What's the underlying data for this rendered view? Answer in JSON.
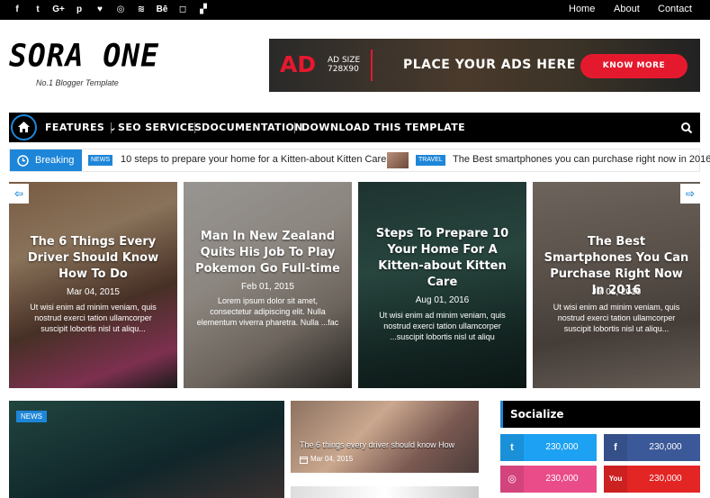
{
  "topbar": {
    "social_icons": [
      "facebook-icon",
      "twitter-icon",
      "google-plus-icon",
      "pinterest-icon",
      "heart-icon",
      "dribbble-icon",
      "rss-icon",
      "behance-icon",
      "instagram-icon",
      "delicious-icon"
    ],
    "social_glyphs": [
      "f",
      "t",
      "G+",
      "p",
      "♥",
      "◎",
      "≋",
      "Bē",
      "◻",
      "▞"
    ],
    "links": [
      "Home",
      "About",
      "Contact"
    ]
  },
  "header": {
    "logo": "SORA ONE",
    "tagline": "No.1 Blogger Template"
  },
  "ad": {
    "big": "AD",
    "size_line1": "AD SIZE",
    "size_line2": "728X90",
    "text": "PLACE YOUR ADS HERE",
    "button": "KNOW MORE",
    "accent": "#e5192e"
  },
  "nav": {
    "items": [
      "FEATURES",
      "SEO SERVICES",
      "DOCUMENTATION",
      "DOWNLOAD THIS TEMPLATE"
    ],
    "accent": "#1e86d8"
  },
  "breaking": {
    "label": "Breaking",
    "items": [
      {
        "tag": "NEWS",
        "title": "10 steps to prepare your home for a Kitten-about Kitten Care"
      },
      {
        "tag": "TRAVEL",
        "title": "The Best smartphones you can purchase right now in 2016"
      }
    ]
  },
  "slider": [
    {
      "title": "The 6 Things Every Driver Should Know How To Do",
      "date": "Mar 04, 2015",
      "excerpt": "Ut wisi enim ad minim veniam, quis nostrud exerci tation ullamcorper suscipit lobortis nisl ut aliqu..."
    },
    {
      "title": "Man In New Zealand Quits His Job To Play Pokemon Go Full-time",
      "date": "Feb 01, 2015",
      "excerpt": "Lorem ipsum dolor sit amet, consectetur adipiscing elit. Nulla elementum viverra pharetra. Nulla ...fac"
    },
    {
      "title": "Steps To Prepare 10 Your Home For A Kitten-about Kitten Care",
      "date": "Aug 01, 2016",
      "excerpt": "Ut wisi enim ad minim veniam, quis nostrud exerci tation ullamcorper ...suscipit lobortis nisl ut aliqu"
    },
    {
      "title": "The Best Smartphones You Can Purchase Right Now In 2016",
      "date": "Jul 01, 2016",
      "excerpt": "Ut wisi enim ad minim veniam, quis nostrud exerci tation ullamcorper suscipit lobortis nisl ut aliqu..."
    }
  ],
  "featured": {
    "tag": "NEWS",
    "small_title": "The 6 things every driver should know How",
    "small_date": "Mar 04, 2015"
  },
  "socialize": {
    "title": "Socialize",
    "buttons": [
      {
        "icon": "twitter-icon",
        "glyph": "t",
        "count": "230,000",
        "color": "#1da1f2"
      },
      {
        "icon": "facebook-icon",
        "glyph": "f",
        "count": "230,000",
        "color": "#3b5998"
      },
      {
        "icon": "dribbble-icon",
        "glyph": "◎",
        "count": "230,000",
        "color": "#ea4c89"
      },
      {
        "icon": "youtube-icon",
        "glyph": "You",
        "count": "230,000",
        "color": "#e32524"
      }
    ]
  }
}
